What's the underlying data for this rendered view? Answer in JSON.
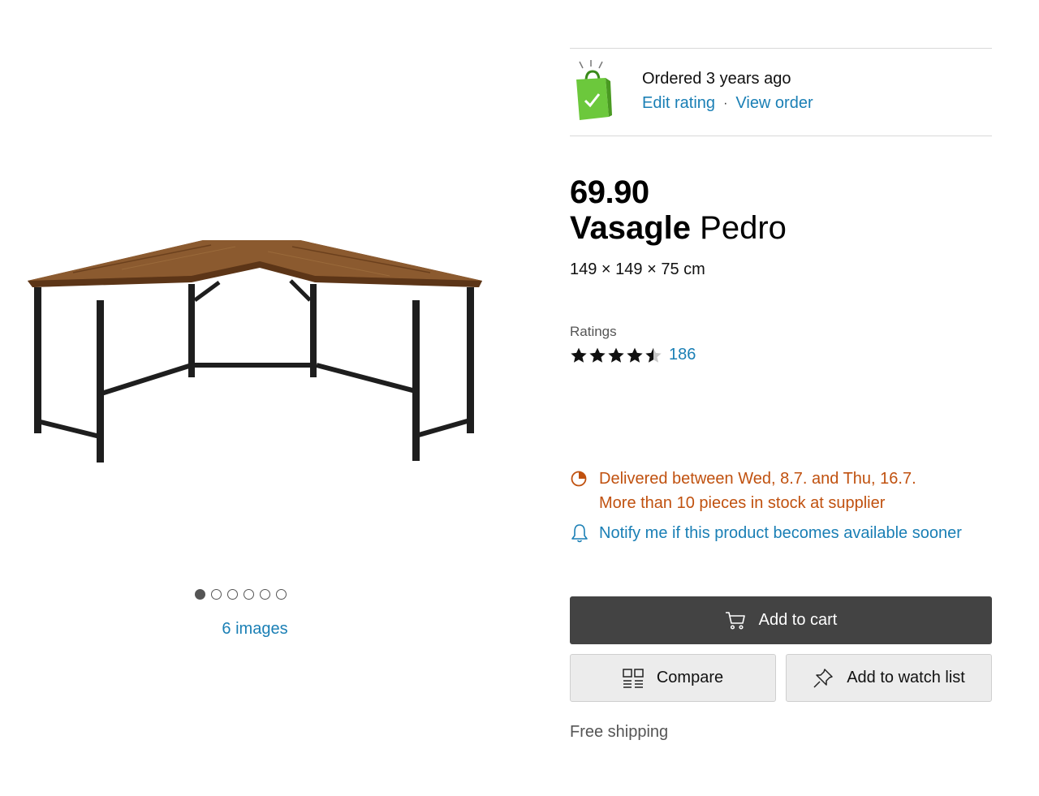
{
  "gallery": {
    "image_alt": "L-shaped desk with rustic brown wood top and black metal frame",
    "dot_count": 6,
    "active_index": 0,
    "images_link": "6 images"
  },
  "order": {
    "status": "Ordered 3 years ago",
    "edit_rating": "Edit rating",
    "separator": "·",
    "view_order": "View order"
  },
  "product": {
    "price": "69.90",
    "brand": "Vasagle",
    "name": "Pedro",
    "dimensions": "149 × 149 × 75 cm"
  },
  "ratings": {
    "label": "Ratings",
    "stars": 4.5,
    "count": "186"
  },
  "delivery": {
    "window": "Delivered between Wed, 8.7. and Thu, 16.7.",
    "stock": "More than 10 pieces in stock at supplier",
    "notify": "Notify me if this product becomes available sooner",
    "color": "#c0510f"
  },
  "actions": {
    "add_to_cart": "Add to cart",
    "compare": "Compare",
    "watch_list": "Add to watch list"
  },
  "shipping": "Free shipping",
  "colors": {
    "link": "#1a7fb5",
    "primary_button": "#434343"
  }
}
